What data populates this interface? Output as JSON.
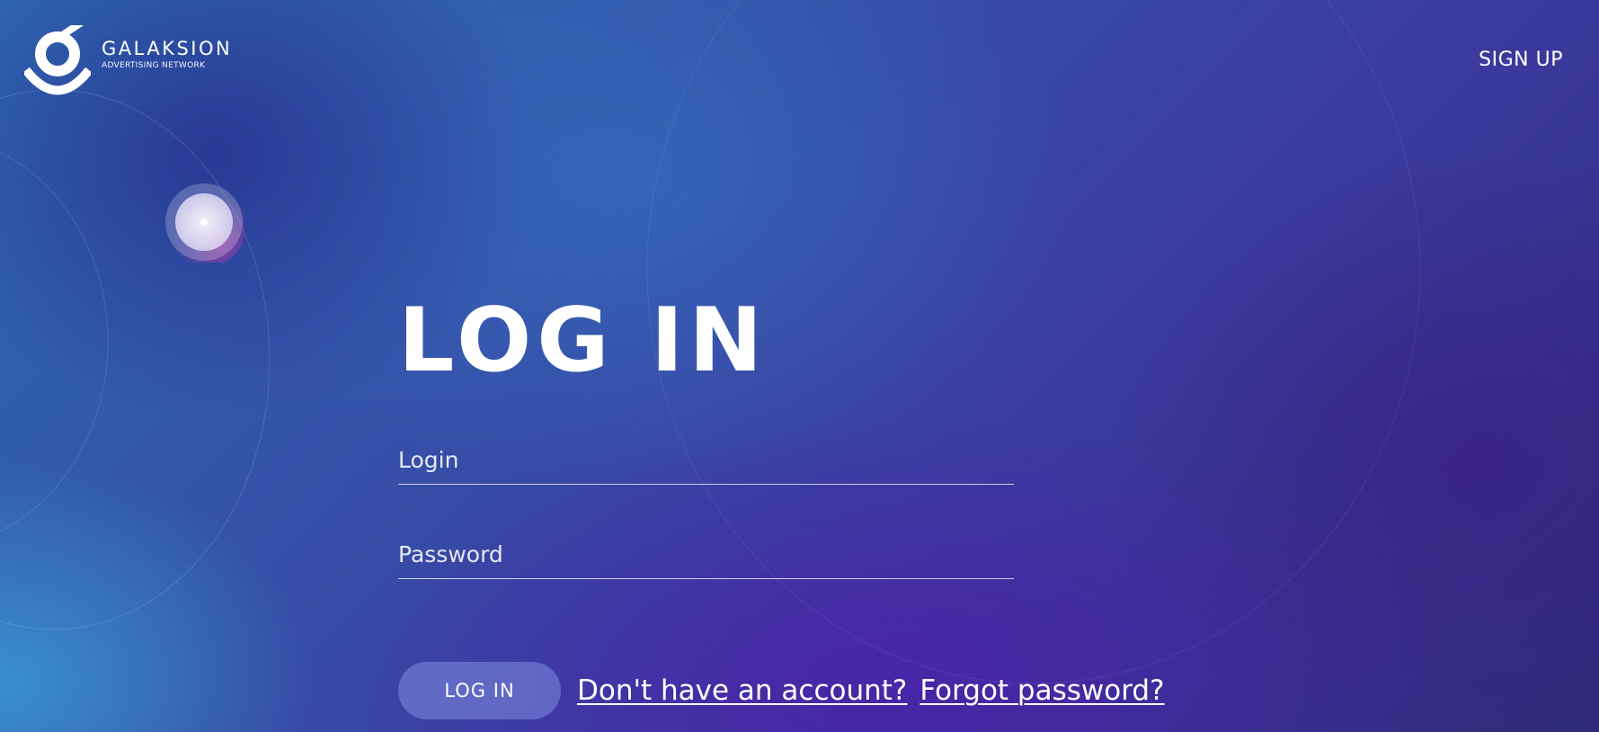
{
  "header": {
    "logo": {
      "name": "GALAKSION",
      "tagline": "ADVERTISING NETWORK",
      "icon": "galaksion-logo-icon"
    },
    "signup_label": "SIGN UP"
  },
  "login_form": {
    "title": "LOG IN",
    "login_field": {
      "value": "",
      "placeholder": "Login"
    },
    "password_field": {
      "value": "",
      "placeholder": "Password"
    },
    "submit_label": "LOG IN",
    "no_account_link": "Don't have an account?",
    "forgot_password_link": "Forgot password?"
  },
  "colors": {
    "background_blue": "#2f6bb4",
    "background_purple": "#3c3a9e",
    "button_fill": "#8ca0eb",
    "text": "#ffffff"
  },
  "decoration": {
    "planet_icon": "glowing-planet-icon"
  }
}
